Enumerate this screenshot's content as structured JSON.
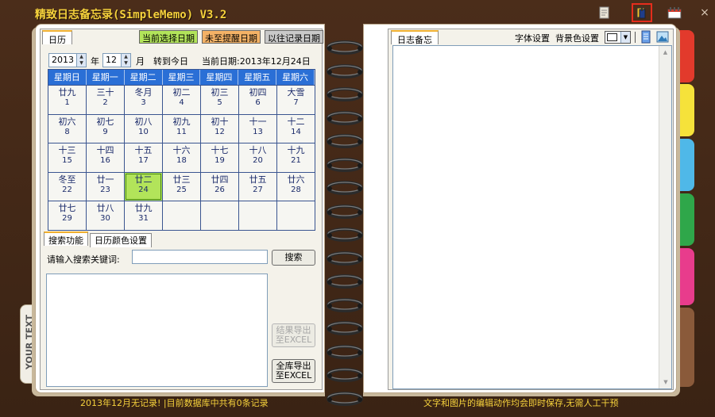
{
  "app": {
    "title": "精致日志备忘录(SimpleMemo) V3.2",
    "close_glyph": "×"
  },
  "left_tabs": {
    "calendar": "日历"
  },
  "legend": {
    "selected": "当前选择日期",
    "not_reminded": "未至提醒日期",
    "past_records": "以往记录日期"
  },
  "date_bar": {
    "year": "2013",
    "year_unit": "年",
    "month": "12",
    "month_unit": "月",
    "goto_today": "转到今日",
    "current_date": "当前日期:2013年12月24日"
  },
  "calendar": {
    "weekdays": [
      "星期日",
      "星期一",
      "星期二",
      "星期三",
      "星期四",
      "星期五",
      "星期六"
    ],
    "cells": [
      {
        "lunar": "廿九",
        "day": "1"
      },
      {
        "lunar": "三十",
        "day": "2"
      },
      {
        "lunar": "冬月",
        "day": "3"
      },
      {
        "lunar": "初二",
        "day": "4"
      },
      {
        "lunar": "初三",
        "day": "5"
      },
      {
        "lunar": "初四",
        "day": "6"
      },
      {
        "lunar": "大雪",
        "day": "7"
      },
      {
        "lunar": "初六",
        "day": "8"
      },
      {
        "lunar": "初七",
        "day": "9"
      },
      {
        "lunar": "初八",
        "day": "10"
      },
      {
        "lunar": "初九",
        "day": "11"
      },
      {
        "lunar": "初十",
        "day": "12"
      },
      {
        "lunar": "十一",
        "day": "13"
      },
      {
        "lunar": "十二",
        "day": "14"
      },
      {
        "lunar": "十三",
        "day": "15"
      },
      {
        "lunar": "十四",
        "day": "16"
      },
      {
        "lunar": "十五",
        "day": "17"
      },
      {
        "lunar": "十六",
        "day": "18"
      },
      {
        "lunar": "十七",
        "day": "19"
      },
      {
        "lunar": "十八",
        "day": "20"
      },
      {
        "lunar": "十九",
        "day": "21"
      },
      {
        "lunar": "冬至",
        "day": "22"
      },
      {
        "lunar": "廿一",
        "day": "23"
      },
      {
        "lunar": "廿二",
        "day": "24"
      },
      {
        "lunar": "廿三",
        "day": "25"
      },
      {
        "lunar": "廿四",
        "day": "26"
      },
      {
        "lunar": "廿五",
        "day": "27"
      },
      {
        "lunar": "廿六",
        "day": "28"
      },
      {
        "lunar": "廿七",
        "day": "29"
      },
      {
        "lunar": "廿八",
        "day": "30"
      },
      {
        "lunar": "廿九",
        "day": "31"
      },
      {
        "lunar": "",
        "day": ""
      },
      {
        "lunar": "",
        "day": ""
      },
      {
        "lunar": "",
        "day": ""
      },
      {
        "lunar": "",
        "day": ""
      }
    ],
    "selected_day": "24"
  },
  "search": {
    "tab_search": "搜索功能",
    "tab_colors": "日历颜色设置",
    "prompt": "请输入搜索关键词:",
    "input_value": "",
    "search_button": "搜索",
    "export_results": [
      "结果导出",
      "至EXCEL"
    ],
    "export_all": [
      "全库导出",
      "至EXCEL"
    ]
  },
  "side_label": "YOUR TEXT",
  "right_panel": {
    "tab": "日志备忘",
    "font_settings": "字体设置",
    "bg_settings": "背景色设置"
  },
  "status": {
    "left": "2013年12月无记录! |目前数据库中共有0条记录",
    "right": "文字和图片的编辑动作均会即时保存,无需人工干预"
  },
  "colors": {
    "title": "#f6d23c",
    "selected_cell": "#b2e45a",
    "legend_selected": "#b2e45a",
    "legend_not_reminded": "#f4b266",
    "legend_past": "#c9c9c9",
    "header_blue": "#2a6fd6",
    "tab_colors": [
      "#e23a2c",
      "#f6e23a",
      "#4fb8e8",
      "#2fa74a",
      "#e83c8c",
      "#8a5a3a"
    ]
  }
}
